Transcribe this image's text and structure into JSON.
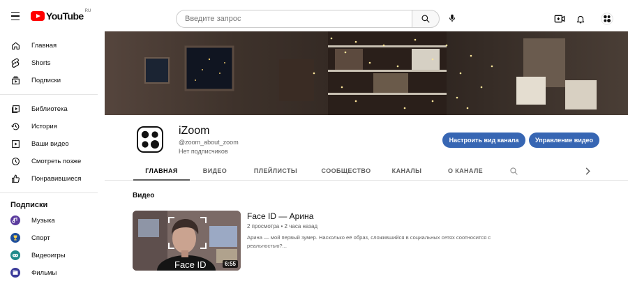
{
  "header": {
    "logo_text": "YouTube",
    "region": "RU",
    "search_placeholder": "Введите запрос"
  },
  "sidebar": {
    "main": [
      {
        "label": "Главная",
        "icon": "home-icon"
      },
      {
        "label": "Shorts",
        "icon": "shorts-icon"
      },
      {
        "label": "Подписки",
        "icon": "subscriptions-icon"
      }
    ],
    "library": [
      {
        "label": "Библиотека",
        "icon": "library-icon"
      },
      {
        "label": "История",
        "icon": "history-icon"
      },
      {
        "label": "Ваши видео",
        "icon": "your-videos-icon"
      },
      {
        "label": "Смотреть позже",
        "icon": "watch-later-icon"
      },
      {
        "label": "Понравившиеся",
        "icon": "liked-icon"
      }
    ],
    "subscriptions_title": "Подписки",
    "subscriptions": [
      {
        "label": "Музыка",
        "color": "#5b3c9e"
      },
      {
        "label": "Спорт",
        "color": "#1e4e9c"
      },
      {
        "label": "Видеоигры",
        "color": "#1f8a8a"
      },
      {
        "label": "Фильмы",
        "color": "#3b3b9a"
      }
    ]
  },
  "channel": {
    "name": "iZoom",
    "handle": "@zoom_about_zoom",
    "subscribers": "Нет подписчиков",
    "customize_button": "Настроить вид канала",
    "manage_button": "Управление видео"
  },
  "tabs": [
    {
      "label": "ГЛАВНАЯ",
      "active": true
    },
    {
      "label": "ВИДЕО",
      "active": false
    },
    {
      "label": "ПЛЕЙЛИСТЫ",
      "active": false
    },
    {
      "label": "СООБЩЕСТВО",
      "active": false
    },
    {
      "label": "КАНАЛЫ",
      "active": false
    },
    {
      "label": "О КАНАЛЕ",
      "active": false
    }
  ],
  "section": {
    "title": "Видео"
  },
  "video": {
    "title": "Face ID — Арина",
    "views": "2 просмотра",
    "separator": "•",
    "age": "2 часа назад",
    "description": "Арина — мой первый зумер. Насколько её образ, сложившийся в социальных сетях соотносится с реальностью?...",
    "duration": "6:55",
    "thumb_label": "Face ID"
  },
  "colors": {
    "accent_blue": "#3766b3",
    "youtube_red": "#ff0000"
  }
}
